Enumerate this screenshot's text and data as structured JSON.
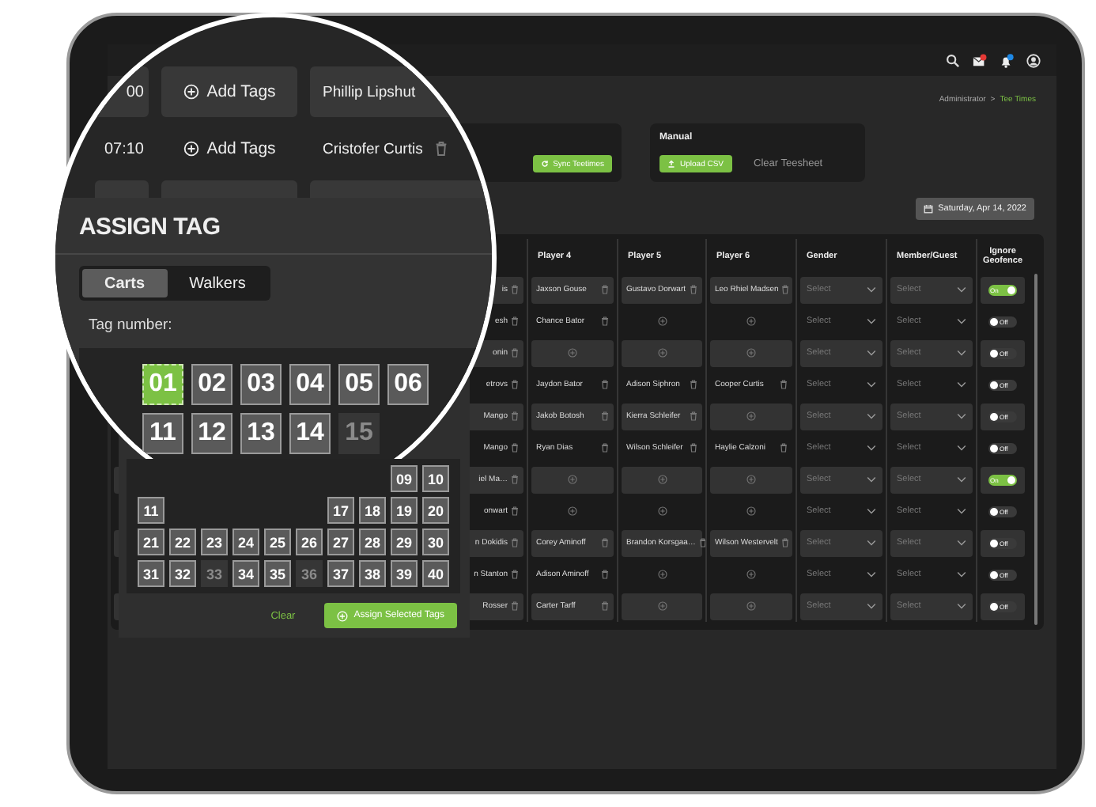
{
  "breadcrumb": {
    "parent": "Administrator",
    "separator": ">",
    "current": "Tee Times"
  },
  "sync_card": {
    "button": "Sync Teetimes"
  },
  "manual_card": {
    "title": "Manual",
    "upload_button": "Upload CSV",
    "clear_button": "Clear Teesheet"
  },
  "date_button": "Saturday, Apr 14, 2022",
  "table": {
    "columns": [
      "Player 4",
      "Player 5",
      "Player 6",
      "Gender",
      "Member/Guest",
      "Ignore Geofence"
    ],
    "rows": [
      {
        "shaded": true,
        "column_1": "is",
        "players": [
          {
            "kind": "name",
            "name": "Jaxson Gouse"
          },
          {
            "kind": "name",
            "name": "Gustavo Dorwart"
          },
          {
            "kind": "name",
            "name": "Leo Rhiel Madsen"
          }
        ],
        "gender": "Select",
        "member_guest": "Select",
        "geofence": {
          "on": true,
          "label": "On"
        }
      },
      {
        "shaded": false,
        "column_1": "esh",
        "players": [
          {
            "kind": "name",
            "name": "Chance Bator"
          },
          {
            "kind": "add"
          },
          {
            "kind": "add"
          }
        ],
        "gender": "Select",
        "member_guest": "Select",
        "geofence": {
          "on": false,
          "label": "Off"
        }
      },
      {
        "shaded": true,
        "column_1": "onin",
        "players": [
          {
            "kind": "add"
          },
          {
            "kind": "add"
          },
          {
            "kind": "add"
          }
        ],
        "gender": "Select",
        "member_guest": "Select",
        "geofence": {
          "on": false,
          "label": "Off"
        }
      },
      {
        "shaded": false,
        "column_1": "etrovs",
        "players": [
          {
            "kind": "name",
            "name": "Jaydon Bator"
          },
          {
            "kind": "name",
            "name": "Adison Siphron"
          },
          {
            "kind": "name",
            "name": "Cooper Curtis"
          }
        ],
        "gender": "Select",
        "member_guest": "Select",
        "geofence": {
          "on": false,
          "label": "Off"
        }
      },
      {
        "shaded": true,
        "column_1": "Mango",
        "players": [
          {
            "kind": "name",
            "name": "Jakob Botosh"
          },
          {
            "kind": "name",
            "name": "Kierra Schleifer"
          },
          {
            "kind": "add"
          }
        ],
        "gender": "Select",
        "member_guest": "Select",
        "geofence": {
          "on": false,
          "label": "Off"
        }
      },
      {
        "shaded": false,
        "column_1": "Mango",
        "players": [
          {
            "kind": "name",
            "name": "Ryan Dias"
          },
          {
            "kind": "name",
            "name": "Wilson Schleifer"
          },
          {
            "kind": "name",
            "name": "Haylie Calzoni"
          }
        ],
        "gender": "Select",
        "member_guest": "Select",
        "geofence": {
          "on": false,
          "label": "Off"
        }
      },
      {
        "shaded": true,
        "column_1": "iel Ma…",
        "players": [
          {
            "kind": "add"
          },
          {
            "kind": "add"
          },
          {
            "kind": "add"
          }
        ],
        "gender": "Select",
        "member_guest": "Select",
        "geofence": {
          "on": true,
          "label": "On"
        }
      },
      {
        "shaded": false,
        "column_1": "onwart",
        "players": [
          {
            "kind": "add"
          },
          {
            "kind": "add"
          },
          {
            "kind": "add"
          }
        ],
        "gender": "Select",
        "member_guest": "Select",
        "geofence": {
          "on": false,
          "label": "Off"
        }
      },
      {
        "shaded": true,
        "column_1": "n Dokidis",
        "players": [
          {
            "kind": "name",
            "name": "Corey Aminoff"
          },
          {
            "kind": "name",
            "name": "Brandon Korsgaa…"
          },
          {
            "kind": "name",
            "name": "Wilson Westervelt"
          }
        ],
        "gender": "Select",
        "member_guest": "Select",
        "geofence": {
          "on": false,
          "label": "Off"
        }
      },
      {
        "shaded": false,
        "column_1": "n Stanton",
        "players": [
          {
            "kind": "name",
            "name": "Adison Aminoff"
          },
          {
            "kind": "add"
          },
          {
            "kind": "add"
          }
        ],
        "gender": "Select",
        "member_guest": "Select",
        "geofence": {
          "on": false,
          "label": "Off"
        }
      },
      {
        "shaded": true,
        "column_1": "Rosser",
        "players": [
          {
            "kind": "name",
            "name": "Carter Tarff"
          },
          {
            "kind": "add"
          },
          {
            "kind": "add"
          }
        ],
        "gender": "Select",
        "member_guest": "Select",
        "geofence": {
          "on": false,
          "label": "Off"
        }
      }
    ]
  },
  "assign_tag": {
    "small_tag_rows": [
      [
        [
          {
            "label": "09",
            "disabled": false
          },
          {
            "label": "10",
            "disabled": false
          }
        ]
      ],
      [
        [
          {
            "label": "11",
            "disabled": false
          }
        ],
        [
          {
            "label": "17",
            "disabled": false
          },
          {
            "label": "18",
            "disabled": false
          },
          {
            "label": "19",
            "disabled": false
          },
          {
            "label": "20",
            "disabled": false
          }
        ]
      ],
      [
        [
          {
            "label": "21",
            "disabled": false
          },
          {
            "label": "22",
            "disabled": false
          },
          {
            "label": "23",
            "disabled": false
          },
          {
            "label": "24",
            "disabled": false
          },
          {
            "label": "25",
            "disabled": false
          },
          {
            "label": "26",
            "disabled": false
          },
          {
            "label": "27",
            "disabled": false
          },
          {
            "label": "28",
            "disabled": false
          },
          {
            "label": "29",
            "disabled": false
          },
          {
            "label": "30",
            "disabled": false
          }
        ]
      ],
      [
        [
          {
            "label": "31",
            "disabled": false
          },
          {
            "label": "32",
            "disabled": false
          },
          {
            "label": "33",
            "disabled": true
          },
          {
            "label": "34",
            "disabled": false
          },
          {
            "label": "35",
            "disabled": false
          },
          {
            "label": "36",
            "disabled": true
          },
          {
            "label": "37",
            "disabled": false
          },
          {
            "label": "38",
            "disabled": false
          },
          {
            "label": "39",
            "disabled": false
          },
          {
            "label": "40",
            "disabled": false
          }
        ]
      ]
    ],
    "clear_button": "Clear",
    "assign_button": "Assign Selected Tags"
  },
  "magnifier": {
    "tee_rows": [
      {
        "shaded": true,
        "time": "00",
        "button": "Add Tags",
        "player": "Phillip Lipshut"
      },
      {
        "shaded": false,
        "time": "07:10",
        "button": "Add Tags",
        "player": "Cristofer Curtis"
      },
      {
        "shaded": true
      }
    ],
    "title": "ASSIGN TAG",
    "tabs": [
      {
        "label": "Carts",
        "selected": true
      },
      {
        "label": "Walkers",
        "selected": false
      }
    ],
    "tag_label": "Tag number:",
    "large_tag_rows": [
      [
        {
          "label": "01",
          "selected": true,
          "disabled": false
        },
        {
          "label": "02",
          "selected": false,
          "disabled": false
        },
        {
          "label": "03",
          "selected": false,
          "disabled": false
        },
        {
          "label": "04",
          "selected": false,
          "disabled": false
        },
        {
          "label": "05",
          "selected": false,
          "disabled": false
        },
        {
          "label": "06",
          "selected": false,
          "disabled": false
        }
      ],
      [
        {
          "label": "11",
          "selected": false,
          "disabled": false
        },
        {
          "label": "12",
          "selected": false,
          "disabled": false
        },
        {
          "label": "13",
          "selected": false,
          "disabled": false
        },
        {
          "label": "14",
          "selected": false,
          "disabled": false
        },
        {
          "label": "15",
          "selected": false,
          "disabled": true
        }
      ]
    ]
  }
}
